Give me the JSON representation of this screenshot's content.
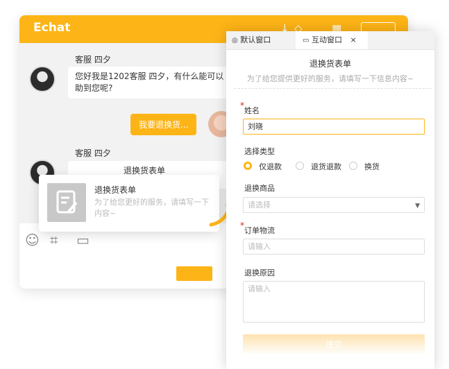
{
  "chat": {
    "logo": "Echat",
    "messages": [
      {
        "agent": "客服 四夕",
        "text_line1": "您好我是1202客服 四夕，有什么能可以",
        "text_line2": "助到您呢?"
      },
      {
        "user_text": "我要退换货..."
      },
      {
        "agent": "客服 四夕",
        "text": "退换货表单"
      }
    ]
  },
  "card": {
    "title": "退换货表单",
    "subtitle": "为了给您更好的服务，请填写一下内容~"
  },
  "panel": {
    "tabs": [
      {
        "label": "默认窗口"
      },
      {
        "label": "互动窗口"
      }
    ],
    "close": "×",
    "title": "退换货表单",
    "subtitle": "为了给您提供更好的服务，请填写一下信息内容~",
    "required_mark": "*",
    "fields": {
      "name": {
        "label": "姓名",
        "value": "刘晓"
      },
      "type": {
        "label": "选择类型",
        "options": [
          "仅退款",
          "退货退款",
          "换货"
        ],
        "selected": 0
      },
      "product": {
        "label": "退换商品",
        "placeholder": "请选择"
      },
      "logistics": {
        "label": "订单物流",
        "placeholder": "请输入"
      },
      "reason": {
        "label": "退换原因",
        "placeholder": "请输入"
      }
    },
    "submit": "提交"
  },
  "colors": {
    "accent": "#fdb416",
    "required": "#e02020"
  }
}
